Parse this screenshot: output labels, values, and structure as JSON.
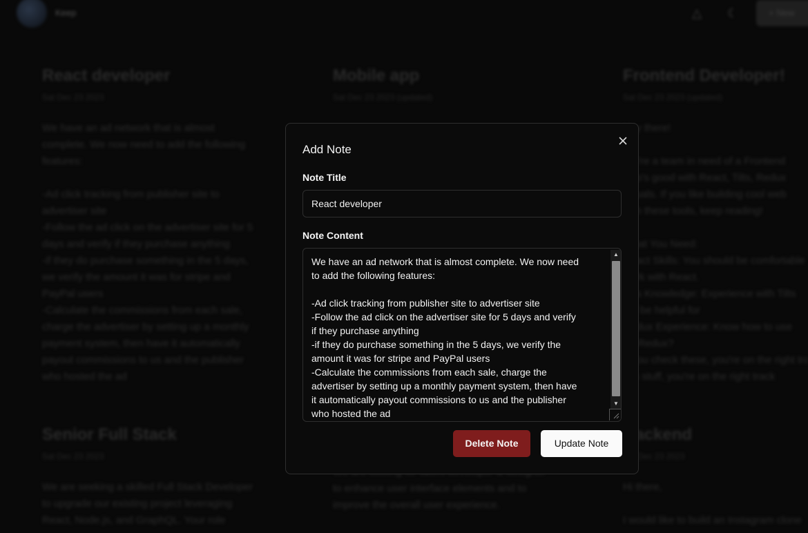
{
  "background": {
    "brand": "Keep",
    "top_button_label": "New",
    "cards": [
      {
        "title": "React developer",
        "date": "Sat Dec 23 2023",
        "body": "We have an ad network that is almost\ncomplete. We now need to add the following\nfeatures:\n\n-Ad click tracking from publisher site to\nadvertiser site\n-Follow the ad click on the advertiser site for 5\ndays and verify if they purchase anything\n-if they do purchase something in the 5 days,\nwe verify the amount it was for stripe and\nPayPal users\n-Calculate the commissions from each sale,\ncharge the advertiser by setting up a monthly\npayment system, then have it automatically\npayout commissions to us and the publisher\nwho hosted the ad"
      },
      {
        "title": "Mobile app",
        "date": "Sat Dec 23 2023 (updated)",
        "body": ""
      },
      {
        "title": "Frontend Developer!",
        "date": "Sat Dec 23 2023 (updated)",
        "body": "Hey there!\n\nWe're a team in need of a Frontend\nwho's good with React, Tilts, Redux\nvisuals. If you like building cool web\nwith these tools, keep reading!\n\nWhat You Need:\nReact Skills: You should be comfortable\nwork with React.\nTilts Knowledge: Experience with Tilts\nwill be helpful for\nRedux Experience: Know how to use\nfor Redux?\nIf you check these, you're on the right track\nthis stuff, you're on the right track"
      },
      {
        "title": "Senior Full Stack",
        "date": "Sat Dec 23 2023",
        "body": "We are seeking a skilled Full Stack Developer\nto upgrade our existing project leveraging\nReact, Node.js, and GraphQL. Your role"
      },
      {
        "title": "",
        "date": "",
        "body": "We are looking for talent developer & designer\nto enhance user interface elements and to\nimprove the overall user experience."
      },
      {
        "title": "Backend",
        "date": "Sat Dec 23 2023",
        "body": "Hi there,\n\nI would like to build an Instagram clone"
      }
    ]
  },
  "modal": {
    "title": "Add Note",
    "title_label": "Note Title",
    "title_value": "React developer",
    "content_label": "Note Content",
    "content_value": "We have an ad network that is almost complete. We now need\nto add the following features:\n\n-Ad click tracking from publisher site to advertiser site\n-Follow the ad click on the advertiser site for 5 days and verify\nif they purchase anything\n-if they do purchase something in the 5 days, we verify the\namount it was for stripe and PayPal users\n-Calculate the commissions from each sale, charge the\nadvertiser by setting up a monthly payment system, then have\nit automatically payout commissions to us and the publisher\nwho hosted the ad",
    "delete_label": "Delete Note",
    "update_label": "Update Note",
    "close_icon": "close-icon"
  },
  "colors": {
    "delete_button": "#7f1d1d",
    "update_button": "#fafafa",
    "modal_bg": "#0b0b0b"
  }
}
